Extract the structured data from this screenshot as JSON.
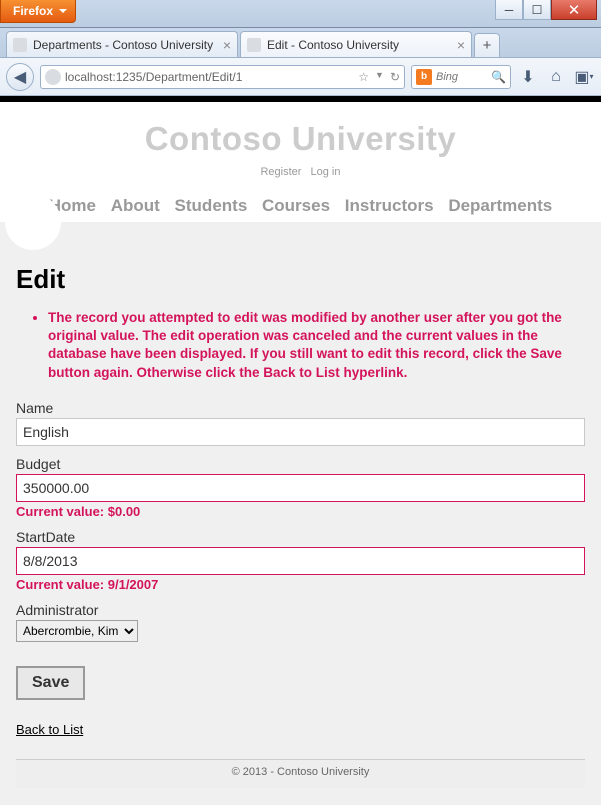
{
  "browser": {
    "app_button": "Firefox",
    "tabs": [
      {
        "title": "Departments - Contoso University"
      },
      {
        "title": "Edit - Contoso University"
      }
    ],
    "url": "localhost:1235/Department/Edit/1",
    "search_placeholder": "Bing"
  },
  "header": {
    "brand": "Contoso University",
    "auth": {
      "register": "Register",
      "login": "Log in"
    },
    "nav": [
      "Home",
      "About",
      "Students",
      "Courses",
      "Instructors",
      "Departments"
    ]
  },
  "page": {
    "title": "Edit",
    "error_summary": "The record you attempted to edit was modified by another user after you got the original value. The edit operation was canceled and the current values in the database have been displayed. If you still want to edit this record, click the Save button again. Otherwise click the Back to List hyperlink.",
    "fields": {
      "name": {
        "label": "Name",
        "value": "English"
      },
      "budget": {
        "label": "Budget",
        "value": "350000.00",
        "current": "Current value: $0.00"
      },
      "startdate": {
        "label": "StartDate",
        "value": "8/8/2013",
        "current": "Current value: 9/1/2007"
      },
      "administrator": {
        "label": "Administrator",
        "value": "Abercrombie, Kim"
      }
    },
    "save_label": "Save",
    "back_label": "Back to List"
  },
  "footer": "© 2013 - Contoso University"
}
